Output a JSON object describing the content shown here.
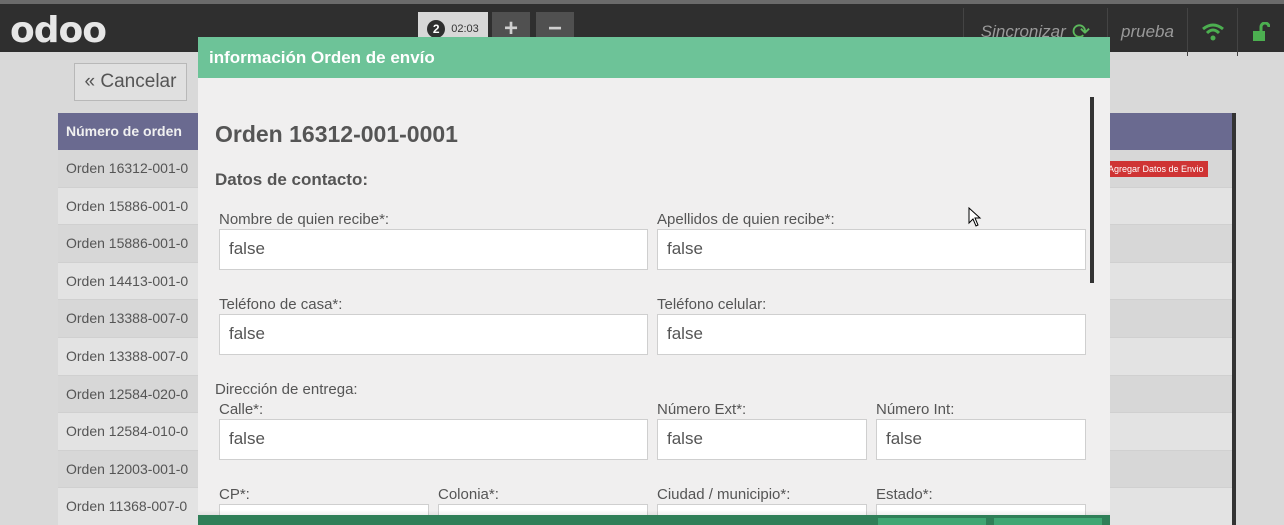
{
  "topbar": {
    "logo": "odoo",
    "order_tab": {
      "number": "2",
      "time": "02:03"
    },
    "add_label": "+",
    "remove_label": "−",
    "sync_label": "Sincronizar",
    "user": "prueba"
  },
  "background": {
    "cancel_label": "« Cancelar",
    "list_header": "Número de orden",
    "rows": [
      "Orden 16312-001-0",
      "Orden 15886-001-0",
      "Orden 15886-001-0",
      "Orden 14413-001-0",
      "Orden 13388-007-0",
      "Orden 13388-007-0",
      "Orden 12584-020-0",
      "Orden 12584-010-0",
      "Orden 12003-001-0",
      "Orden 11368-007-0"
    ],
    "badge_label": "Agregar Datos de Envio"
  },
  "modal": {
    "header": "información Orden de envío",
    "title": "Orden 16312-001-0001",
    "contact_heading": "Datos de contacto:",
    "fields": {
      "nombre": {
        "label": "Nombre de quien recibe*:",
        "value": "false"
      },
      "apellidos": {
        "label": "Apellidos de quien recibe*:",
        "value": "false"
      },
      "tel_casa": {
        "label": "Teléfono de casa*:",
        "value": "false"
      },
      "tel_cel": {
        "label": "Teléfono celular:",
        "value": "false"
      },
      "direccion_heading": "Dirección de entrega:",
      "calle": {
        "label": "Calle*:",
        "value": "false"
      },
      "num_ext": {
        "label": "Número Ext*:",
        "value": "false"
      },
      "num_int": {
        "label": "Número Int:",
        "value": "false"
      },
      "cp": {
        "label": "CP*:"
      },
      "colonia": {
        "label": "Colonia*:"
      },
      "ciudad": {
        "label": "Ciudad / municipio*:"
      },
      "estado": {
        "label": "Estado*:"
      }
    }
  },
  "colors": {
    "topbar": "#2f2f2f",
    "modal_header": "#6dc398",
    "list_header": "#6a6a90",
    "badge": "#cf3434",
    "sync_icon": "#5cb85c"
  }
}
